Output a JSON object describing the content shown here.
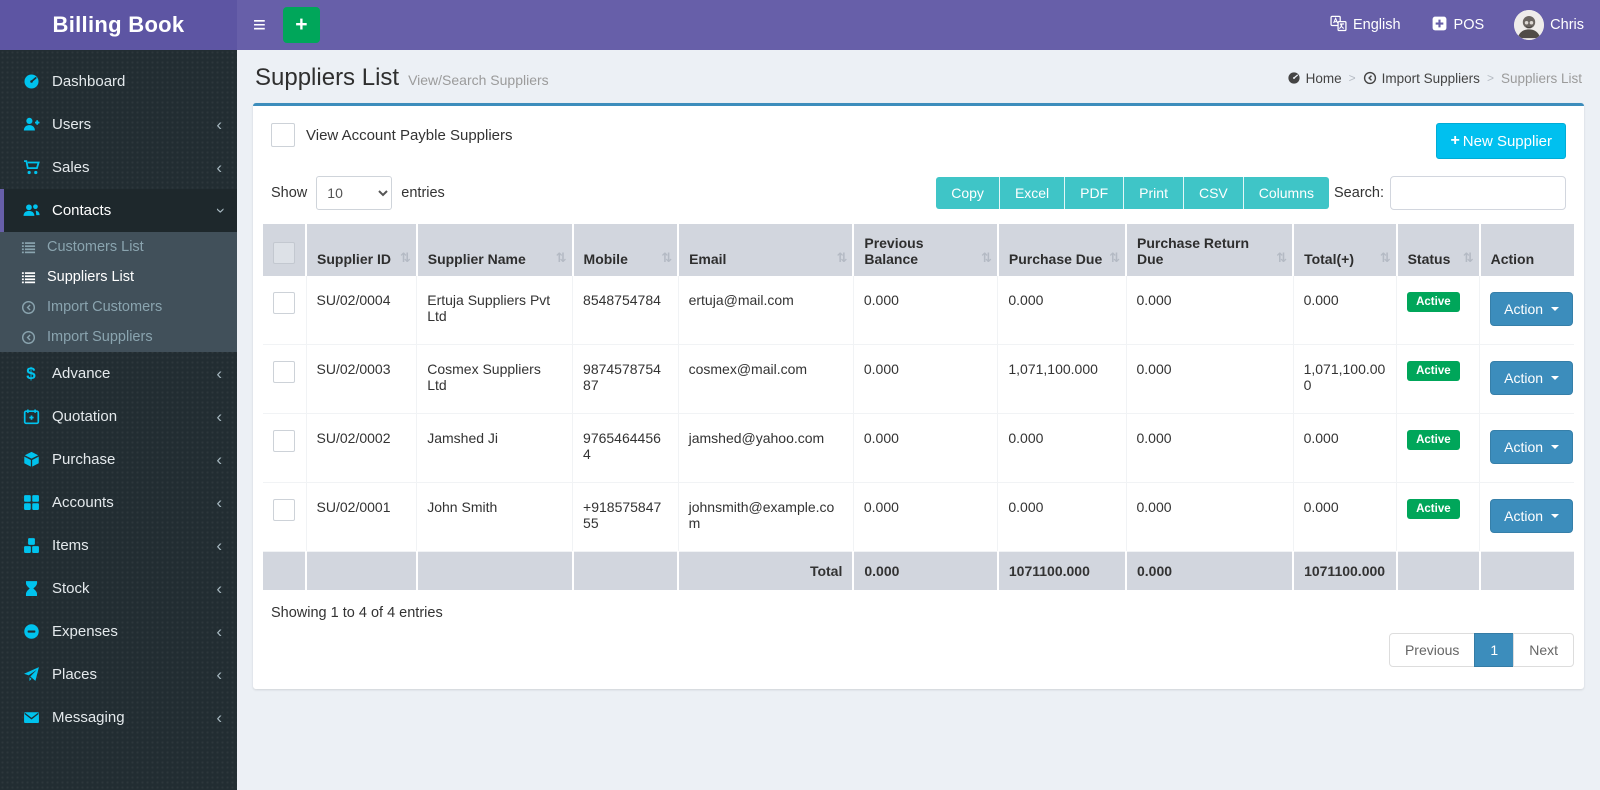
{
  "app": {
    "title": "Billing Book"
  },
  "colors": {
    "navbar_purple": "#675fa9",
    "logo_purple": "#5d55a3",
    "sidebar_dark": "#222d32",
    "icon_cyan": "#00c3ee",
    "accent_blue": "#3c8dbc",
    "button_cyan": "#00c0ef",
    "export_teal": "#3fc5c7",
    "success_green": "#00a65a",
    "table_header_gray": "#d2d6de"
  },
  "icons": {
    "hamburger": "≡",
    "plus": "+",
    "chevron_left": "‹",
    "sort": "⇅",
    "breadcrumb_sep": ">",
    "dollar": "$"
  },
  "navbar": {
    "language": "English",
    "pos": "POS",
    "user_name": "Chris"
  },
  "sidebar": {
    "items": [
      {
        "label": "Dashboard"
      },
      {
        "label": "Users"
      },
      {
        "label": "Sales"
      },
      {
        "label": "Contacts"
      },
      {
        "label": "Advance"
      },
      {
        "label": "Quotation"
      },
      {
        "label": "Purchase"
      },
      {
        "label": "Accounts"
      },
      {
        "label": "Items"
      },
      {
        "label": "Stock"
      },
      {
        "label": "Expenses"
      },
      {
        "label": "Places"
      },
      {
        "label": "Messaging"
      }
    ],
    "contacts_submenu": [
      {
        "label": "Customers List"
      },
      {
        "label": "Suppliers List"
      },
      {
        "label": "Import Customers"
      },
      {
        "label": "Import Suppliers"
      }
    ]
  },
  "page": {
    "title": "Suppliers List",
    "subtitle": "View/Search Suppliers",
    "breadcrumb": {
      "home": "Home",
      "parent": "Import Suppliers",
      "current": "Suppliers List"
    }
  },
  "toolbar": {
    "view_payable_label": "View Account Payble Suppliers",
    "new_supplier_label": "New Supplier",
    "show_label": "Show",
    "page_length": "10",
    "entries_label": "entries",
    "export_buttons": {
      "copy": "Copy",
      "excel": "Excel",
      "pdf": "PDF",
      "print": "Print",
      "csv": "CSV",
      "columns": "Columns"
    },
    "search_label": "Search:"
  },
  "table": {
    "columns": [
      "Supplier ID",
      "Supplier Name",
      "Mobile",
      "Email",
      "Previous Balance",
      "Purchase Due",
      "Purchase Return Due",
      "Total(+)",
      "Status",
      "Action"
    ],
    "rows": [
      {
        "id": "SU/02/0004",
        "name": "Ertuja Suppliers Pvt Ltd",
        "mobile": "8548754784",
        "email": "ertuja@mail.com",
        "previous_balance": "0.000",
        "purchase_due": "0.000",
        "purchase_return_due": "0.000",
        "total": "0.000",
        "status": "Active",
        "action": "Action"
      },
      {
        "id": "SU/02/0003",
        "name": "Cosmex Suppliers Ltd",
        "mobile": "987457875487",
        "email": "cosmex@mail.com",
        "previous_balance": "0.000",
        "purchase_due": "1,071,100.000",
        "purchase_return_due": "0.000",
        "total": "1,071,100.000",
        "status": "Active",
        "action": "Action"
      },
      {
        "id": "SU/02/0002",
        "name": "Jamshed Ji",
        "mobile": "97654644564",
        "email": "jamshed@yahoo.com",
        "previous_balance": "0.000",
        "purchase_due": "0.000",
        "purchase_return_due": "0.000",
        "total": "0.000",
        "status": "Active",
        "action": "Action"
      },
      {
        "id": "SU/02/0001",
        "name": "John Smith",
        "mobile": "+91857584755",
        "email": "johnsmith@example.com",
        "previous_balance": "0.000",
        "purchase_due": "0.000",
        "purchase_return_due": "0.000",
        "total": "0.000",
        "status": "Active",
        "action": "Action"
      }
    ],
    "footer": {
      "label": "Total",
      "previous_balance": "0.000",
      "purchase_due": "1071100.000",
      "purchase_return_due": "0.000",
      "total": "1071100.000"
    }
  },
  "summary": {
    "info": "Showing 1 to 4 of 4 entries"
  },
  "pagination": {
    "previous": "Previous",
    "page": "1",
    "next": "Next"
  }
}
